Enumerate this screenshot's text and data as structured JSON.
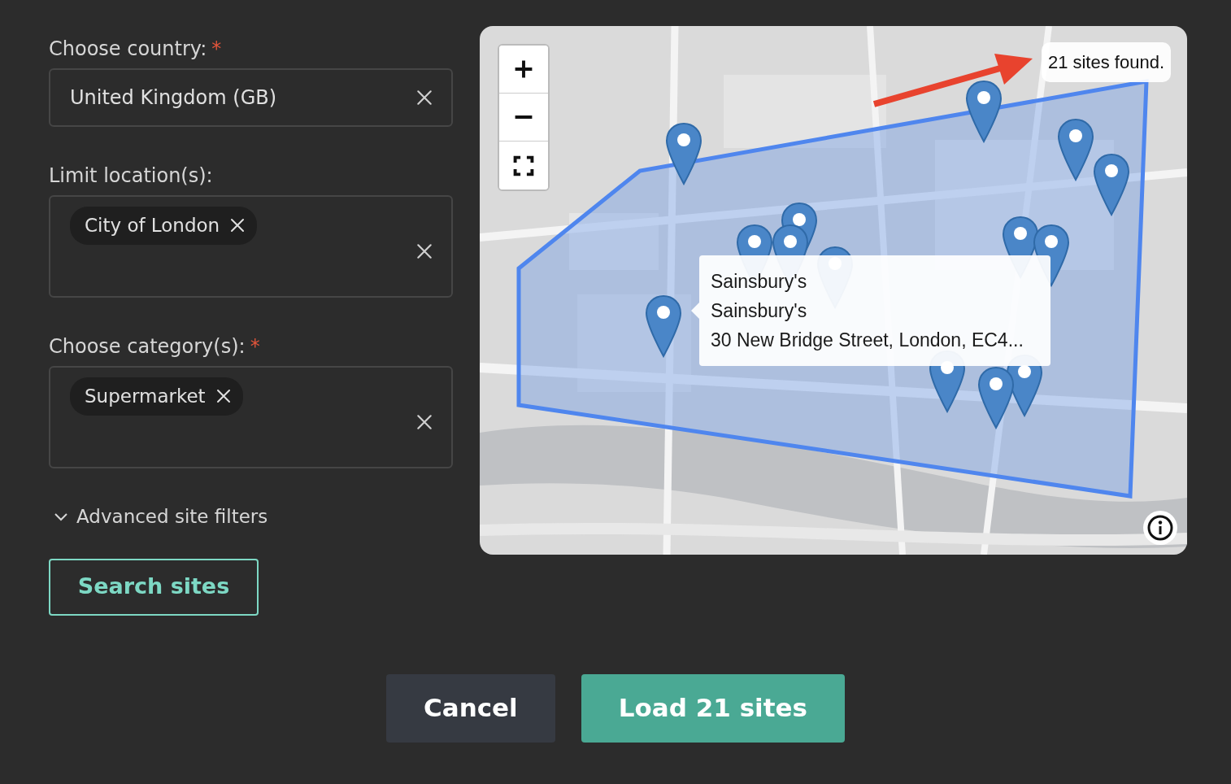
{
  "form": {
    "fields": [
      {
        "label": "Choose country:",
        "required_mark": "*",
        "kind": "select",
        "value": "United Kingdom (GB)"
      },
      {
        "label": "Limit location(s):",
        "kind": "multiselect",
        "chips": [
          "City of London"
        ]
      },
      {
        "label": "Choose category(s):",
        "required_mark": "*",
        "kind": "multiselect",
        "chips": [
          "Supermarket"
        ]
      }
    ],
    "advanced": {
      "label": "Advanced site filters",
      "expanded": false
    },
    "search_button": "Search sites"
  },
  "map": {
    "result_count": "21 sites found.",
    "tooltip": {
      "lines": [
        "Sainsbury's",
        "Sainsbury's",
        "30 New Bridge Street, London, EC4..."
      ]
    }
  },
  "buttons": [
    {
      "label": "Cancel",
      "kind": "secondary"
    },
    {
      "label": "Load 21 sites",
      "kind": "primary"
    }
  ]
}
